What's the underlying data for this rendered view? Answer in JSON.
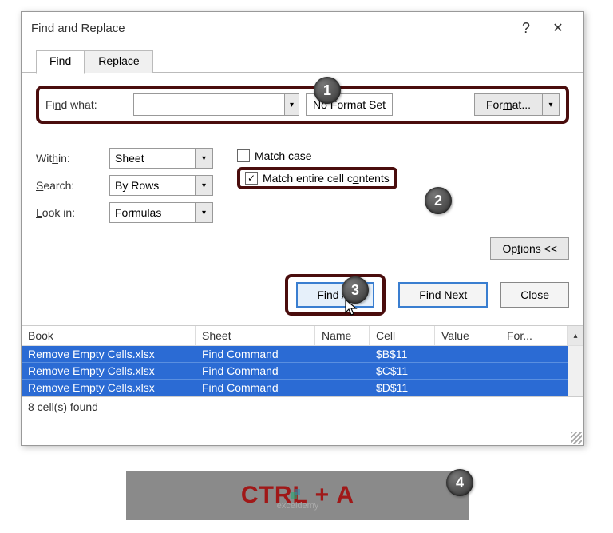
{
  "dialog": {
    "title": "Find and Replace",
    "tabs": {
      "find": "Find",
      "replace": "Replace"
    },
    "findwhat_label": "Find what:",
    "findwhat_value": "",
    "noformat": "No Format Set",
    "format_btn": "Format...",
    "within": {
      "label": "Within:",
      "value": "Sheet"
    },
    "search": {
      "label": "Search:",
      "value": "By Rows"
    },
    "lookin": {
      "label": "Look in:",
      "value": "Formulas"
    },
    "match_case": "Match case",
    "match_entire": "Match entire cell contents",
    "options_btn": "Options <<",
    "findall": "Find All",
    "findnext": "Find Next",
    "close": "Close",
    "result_headers": {
      "book": "Book",
      "sheet": "Sheet",
      "name": "Name",
      "cell": "Cell",
      "value": "Value",
      "formula": "For..."
    },
    "results": [
      {
        "book": "Remove Empty Cells.xlsx",
        "sheet": "Find Command",
        "name": "",
        "cell": "$B$11",
        "value": ""
      },
      {
        "book": "Remove Empty Cells.xlsx",
        "sheet": "Find Command",
        "name": "",
        "cell": "$C$11",
        "value": ""
      },
      {
        "book": "Remove Empty Cells.xlsx",
        "sheet": "Find Command",
        "name": "",
        "cell": "$D$11",
        "value": ""
      }
    ],
    "status": "8 cell(s) found"
  },
  "badges": {
    "b1": "1",
    "b2": "2",
    "b3": "3",
    "b4": "4"
  },
  "keylabel": "CTRL + A",
  "watermark": "exceldemy"
}
